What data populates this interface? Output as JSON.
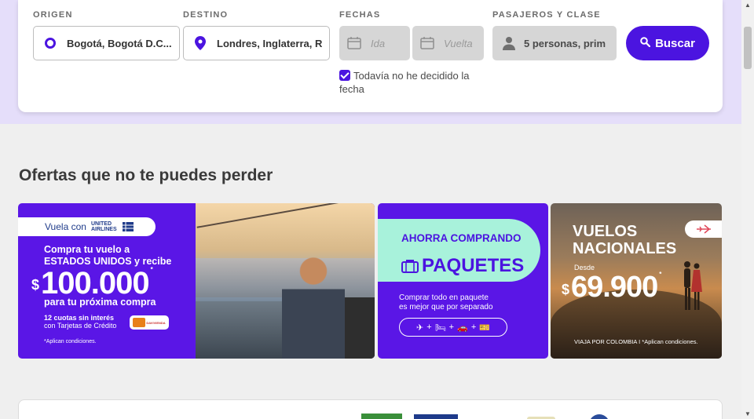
{
  "search": {
    "origin_label": "ORIGEN",
    "origin_value": "Bogotá, Bogotá D.C...",
    "destination_label": "DESTINO",
    "destination_value": "Londres, Inglaterra, R",
    "dates_label": "FECHAS",
    "departure_placeholder": "Ida",
    "return_placeholder": "Vuelta",
    "passengers_label": "PASAJEROS Y CLASE",
    "passengers_value": "5 personas, prim",
    "search_button": "Buscar",
    "undecided_checkbox": "Todavía no he decidido la fecha",
    "undecided_checked": true
  },
  "offers": {
    "title": "Ofertas que no te puedes perder",
    "banner1": {
      "pill_text": "Vuela con",
      "airline": "UNITED AIRLINES",
      "line1": "Compra tu vuelo a",
      "line2": "ESTADOS UNIDOS y recibe",
      "currency": "$",
      "amount": "100.000",
      "asterisk": "*",
      "line3": "para tu próxima compra",
      "cuotas_bold": "12 cuotas sin interés",
      "cuotas_rest": "con Tarjetas de Crédito",
      "card_brand": "DAVIVIENDA",
      "disclaimer": "*Aplican condiciones."
    },
    "banner2": {
      "title1": "AHORRA COMPRANDO",
      "title2": "PAQUETES",
      "desc1": "Comprar todo en paquete",
      "desc2": "es mejor que por separado",
      "icons": [
        "plane-icon",
        "bed-icon",
        "car-icon",
        "ticket-icon"
      ]
    },
    "banner3": {
      "title1": "VUELOS",
      "title2": "NACIONALES",
      "desde": "Desde",
      "currency": "$",
      "amount": "69.900",
      "asterisk": "*",
      "footer": "VIAJA POR COLOMBIA I *Aplican condiciones."
    }
  },
  "colors": {
    "accent": "#4b14e0",
    "band": "#e5defa",
    "mint": "#a8f2db"
  }
}
